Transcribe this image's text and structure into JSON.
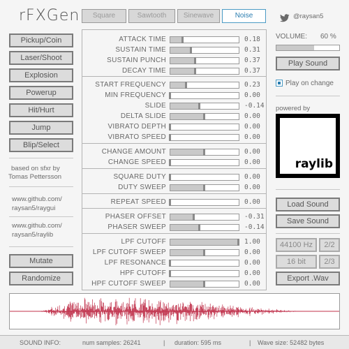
{
  "app": {
    "title": "rFXGen"
  },
  "wave_tabs": [
    "Square",
    "Sawtooth",
    "Sinewave",
    "Noise"
  ],
  "active_wave": "Noise",
  "presets": [
    "Pickup/Coin",
    "Laser/Shoot",
    "Explosion",
    "Powerup",
    "Hit/Hurt",
    "Jump",
    "Blip/Select"
  ],
  "credits": {
    "based_on_line1": "based on sfxr by",
    "based_on_line2": "Tomas Pettersson",
    "raygui_line1": "www.github.com/",
    "raygui_line2": "raysan5/raygui",
    "raylib_line1": "www.github.com/",
    "raylib_line2": "raysan5/raylib"
  },
  "actions": {
    "mutate": "Mutate",
    "randomize": "Randomize"
  },
  "sliders": [
    {
      "label": "ATTACK TIME",
      "value": "0.18",
      "fill": 0.18
    },
    {
      "label": "SUSTAIN TIME",
      "value": "0.31",
      "fill": 0.31
    },
    {
      "label": "SUSTAIN PUNCH",
      "value": "0.37",
      "fill": 0.37
    },
    {
      "label": "DECAY TIME",
      "value": "0.37",
      "fill": 0.37
    },
    {
      "label": "START FREQUENCY",
      "value": "0.23",
      "fill": 0.23
    },
    {
      "label": "MIN FREQUENCY",
      "value": "0.00",
      "fill": 0.0
    },
    {
      "label": "SLIDE",
      "value": "-0.14",
      "fill": 0.43
    },
    {
      "label": "DELTA SLIDE",
      "value": "0.00",
      "fill": 0.5
    },
    {
      "label": "VIBRATO DEPTH",
      "value": "0.00",
      "fill": 0.0
    },
    {
      "label": "VIBRATO SPEED",
      "value": "0.00",
      "fill": 0.0
    },
    {
      "label": "CHANGE AMOUNT",
      "value": "0.00",
      "fill": 0.5
    },
    {
      "label": "CHANGE SPEED",
      "value": "0.00",
      "fill": 0.0
    },
    {
      "label": "SQUARE DUTY",
      "value": "0.00",
      "fill": 0.0
    },
    {
      "label": "DUTY SWEEP",
      "value": "0.00",
      "fill": 0.5
    },
    {
      "label": "REPEAT SPEED",
      "value": "0.00",
      "fill": 0.0
    },
    {
      "label": "PHASER OFFSET",
      "value": "-0.31",
      "fill": 0.345
    },
    {
      "label": "PHASER SWEEP",
      "value": "-0.14",
      "fill": 0.43
    },
    {
      "label": "LPF CUTOFF",
      "value": "1.00",
      "fill": 1.0
    },
    {
      "label": "LPF CUTOFF SWEEP",
      "value": "0.00",
      "fill": 0.5
    },
    {
      "label": "LPF RESONANCE",
      "value": "0.00",
      "fill": 0.0
    },
    {
      "label": "HPF CUTOFF",
      "value": "0.00",
      "fill": 0.0
    },
    {
      "label": "HPF CUTOFF SWEEP",
      "value": "0.00",
      "fill": 0.5
    }
  ],
  "right_panel": {
    "twitter_handle": "@raysan5",
    "twitter_icon": "twitter-bird-icon",
    "volume_label": "VOLUME:",
    "volume_value": "60 %",
    "volume_fill": 0.6,
    "play_sound": "Play Sound",
    "play_on_change": "Play on change",
    "play_on_change_checked": true,
    "powered_by": "powered by",
    "raylib_logo_text": "raylib",
    "load_sound": "Load Sound",
    "save_sound": "Save Sound",
    "sample_rate": "44100 Hz",
    "sample_rate_toggle": "2/2",
    "bit_depth": "16 bit",
    "bit_depth_toggle": "2/3",
    "export": "Export .Wav"
  },
  "status": {
    "label": "SOUND INFO:",
    "samples": "num samples: 26241",
    "duration": "duration: 595 ms",
    "wave_size": "Wave size: 52482 bytes",
    "sep": "|"
  },
  "colors": {
    "accent": "#2a7db0",
    "waveform": "#c0304a",
    "panel_border": "#b4b4b4"
  }
}
